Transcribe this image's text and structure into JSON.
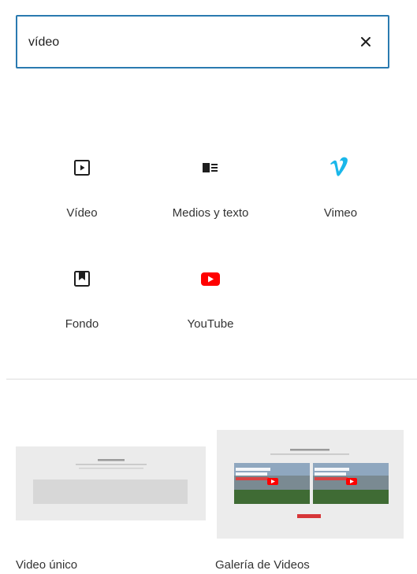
{
  "search": {
    "value": "vídeo",
    "clear_icon": "close-icon"
  },
  "blocks": [
    {
      "label": "Vídeo",
      "icon": "video-icon"
    },
    {
      "label": "Medios y texto",
      "icon": "media-text-icon"
    },
    {
      "label": "Vimeo",
      "icon": "vimeo-icon",
      "color": "#1ab7ea"
    },
    {
      "label": "Fondo",
      "icon": "cover-icon"
    },
    {
      "label": "YouTube",
      "icon": "youtube-icon",
      "color": "#ff0000"
    }
  ],
  "patterns": [
    {
      "label": "Video único"
    },
    {
      "label": "Galería de Videos"
    }
  ],
  "colors": {
    "accent": "#2a7ab0",
    "youtube": "#ff0000",
    "vimeo": "#1ab7ea"
  }
}
